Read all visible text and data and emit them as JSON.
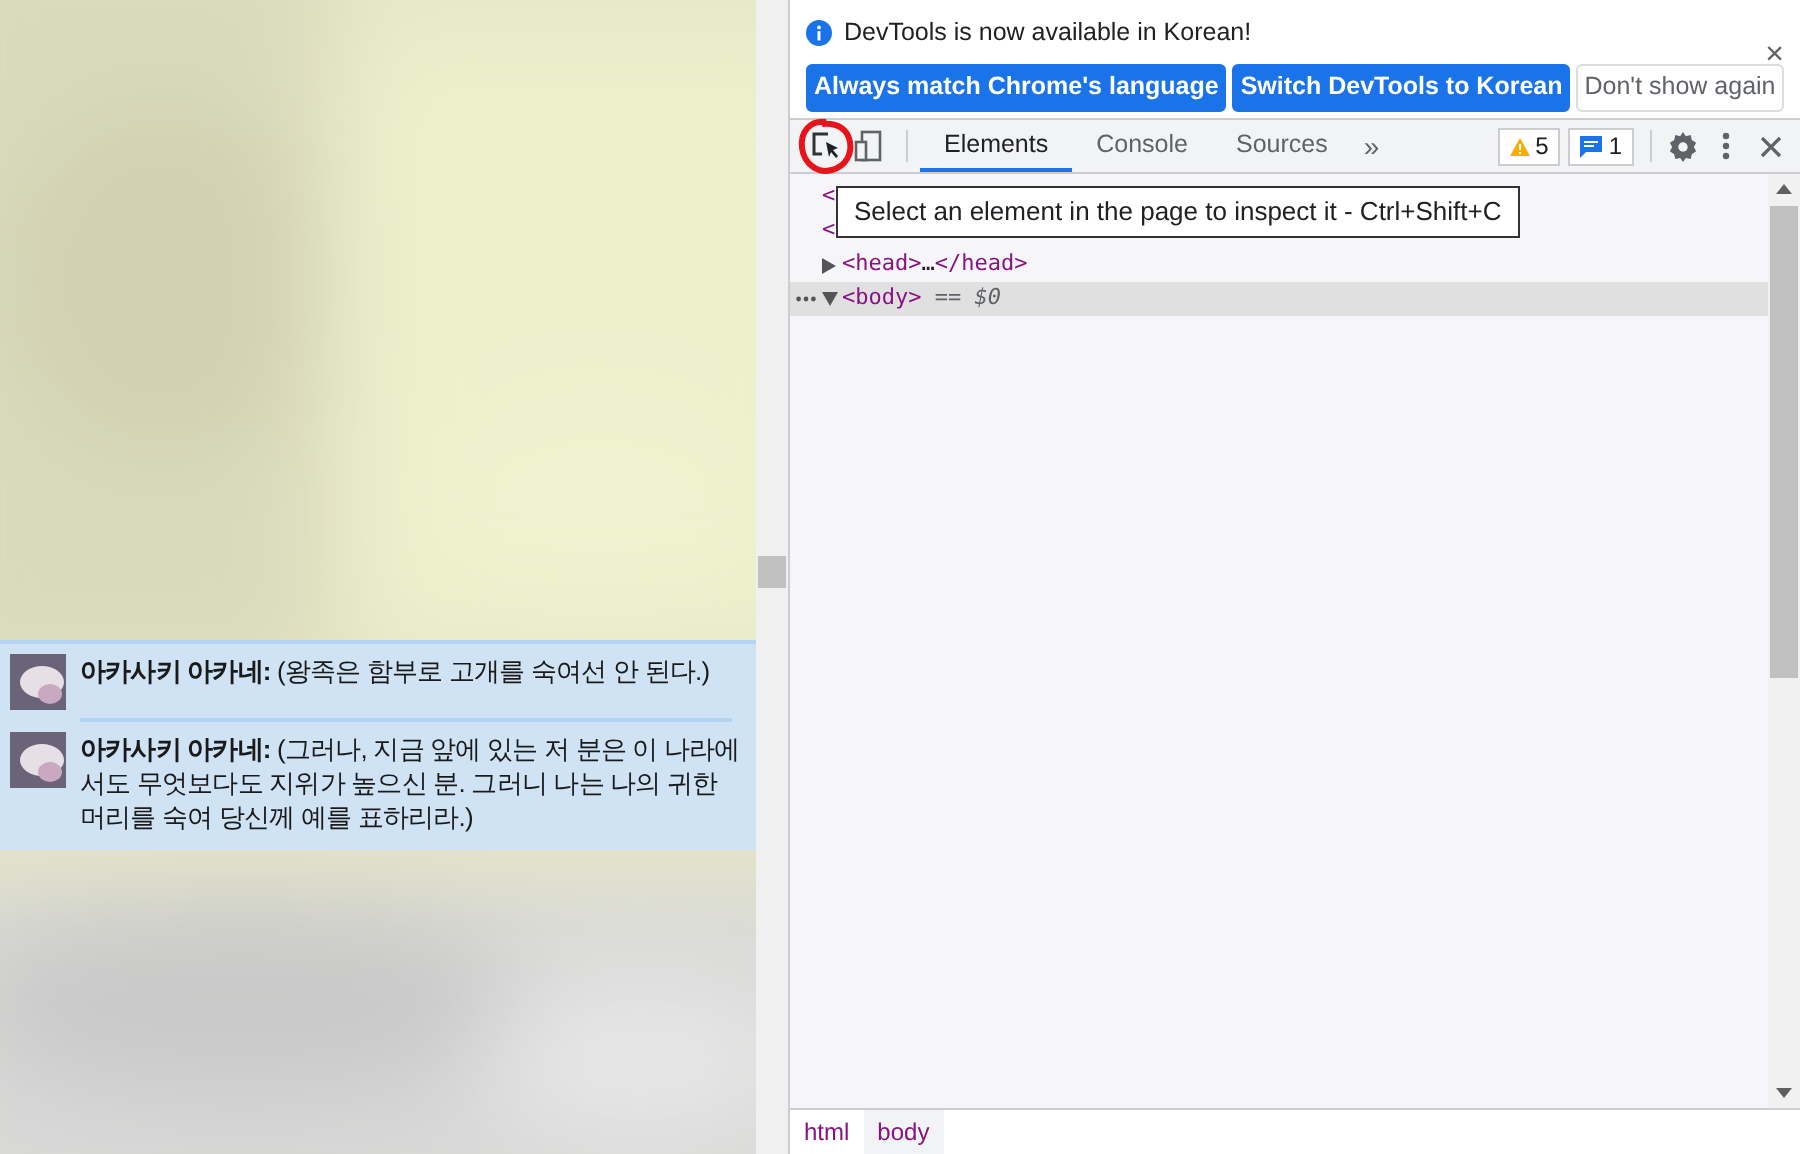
{
  "page": {
    "chat": [
      {
        "speaker": "아카사키 아카네:",
        "text": "(왕족은 함부로 고개를 숙여선 안 된다.)"
      },
      {
        "speaker": "아카사키 아카네:",
        "text": "(그러나, 지금 앞에 있는 저 분은 이 나라에서도 무엇보다도 지위가 높으신 분. 그러니 나는 나의 귀한 머리를 숙여 당신께 예를 표하리라.)"
      }
    ]
  },
  "devtools": {
    "infobar": {
      "message": "DevTools is now available in Korean!",
      "buttons": [
        {
          "label": "Always match Chrome's language",
          "kind": "primary"
        },
        {
          "label": "Switch DevTools to Korean",
          "kind": "primary"
        },
        {
          "label": "Don't show again",
          "kind": "plain"
        }
      ],
      "close": "×"
    },
    "tabs": [
      {
        "label": "Elements",
        "selected": true
      },
      {
        "label": "Console",
        "selected": false
      },
      {
        "label": "Sources",
        "selected": false
      }
    ],
    "more_tabs": "»",
    "warnings": "5",
    "messages": "1",
    "tooltip": "Select an element in the page to inspect it - Ctrl+Shift+C",
    "dom": [
      {
        "kind": "partial",
        "text": "<"
      },
      {
        "kind": "partial",
        "text": "<"
      },
      {
        "kind": "node",
        "open": "<head>",
        "ellipsis": "…",
        "close": "</head>",
        "expanded": false,
        "selected": false
      },
      {
        "kind": "node",
        "open": "<body>",
        "note": "== $0",
        "expanded": true,
        "selected": true
      }
    ],
    "breadcrumbs": [
      {
        "label": "html",
        "selected": false
      },
      {
        "label": "body",
        "selected": true
      }
    ]
  }
}
